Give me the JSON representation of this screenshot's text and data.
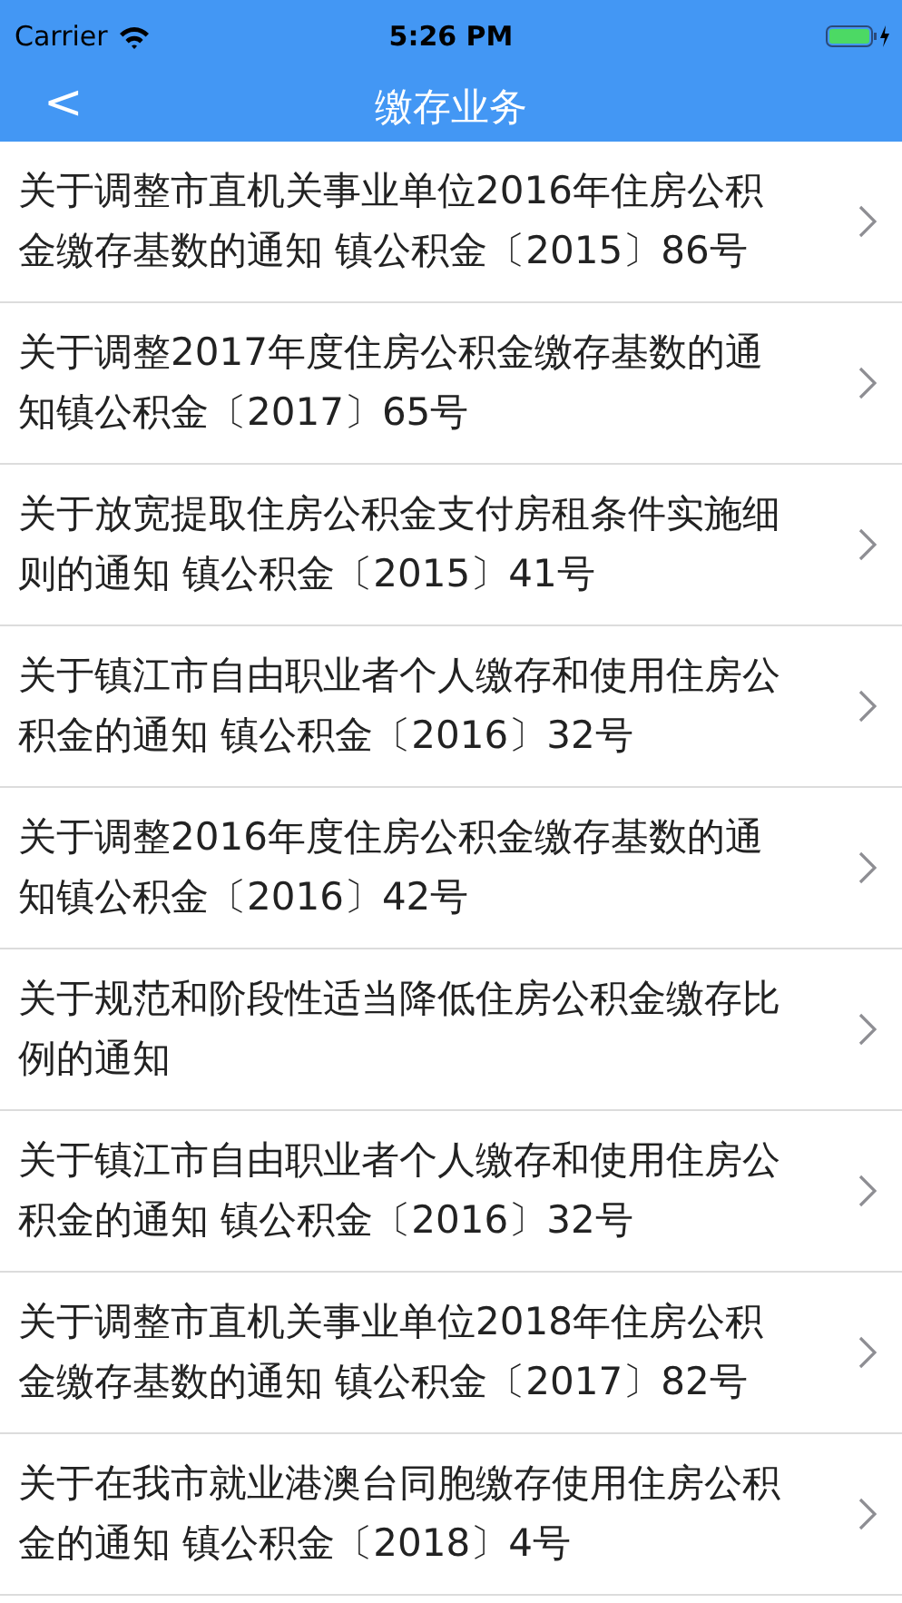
{
  "status_bar": {
    "carrier": "Carrier",
    "time": "5:26 PM"
  },
  "nav_bar": {
    "back": "<",
    "title": "缴存业务"
  },
  "items": [
    {
      "text": "关于调整市直机关事业单位2016年住房公积金缴存基数的通知 镇公积金〔2015〕86号"
    },
    {
      "text": "关于调整2017年度住房公积金缴存基数的通知镇公积金〔2017〕65号"
    },
    {
      "text": "关于放宽提取住房公积金支付房租条件实施细则的通知 镇公积金〔2015〕41号"
    },
    {
      "text": "关于镇江市自由职业者个人缴存和使用住房公积金的通知 镇公积金〔2016〕32号"
    },
    {
      "text": "关于调整2016年度住房公积金缴存基数的通知镇公积金〔2016〕42号"
    },
    {
      "text": "关于规范和阶段性适当降低住房公积金缴存比例的通知"
    },
    {
      "text": "关于镇江市自由职业者个人缴存和使用住房公积金的通知 镇公积金〔2016〕32号"
    },
    {
      "text": "关于调整市直机关事业单位2018年住房公积金缴存基数的通知 镇公积金〔2017〕82号"
    },
    {
      "text": "关于在我市就业港澳台同胞缴存使用住房公积金的通知 镇公积金〔2018〕4号"
    }
  ]
}
